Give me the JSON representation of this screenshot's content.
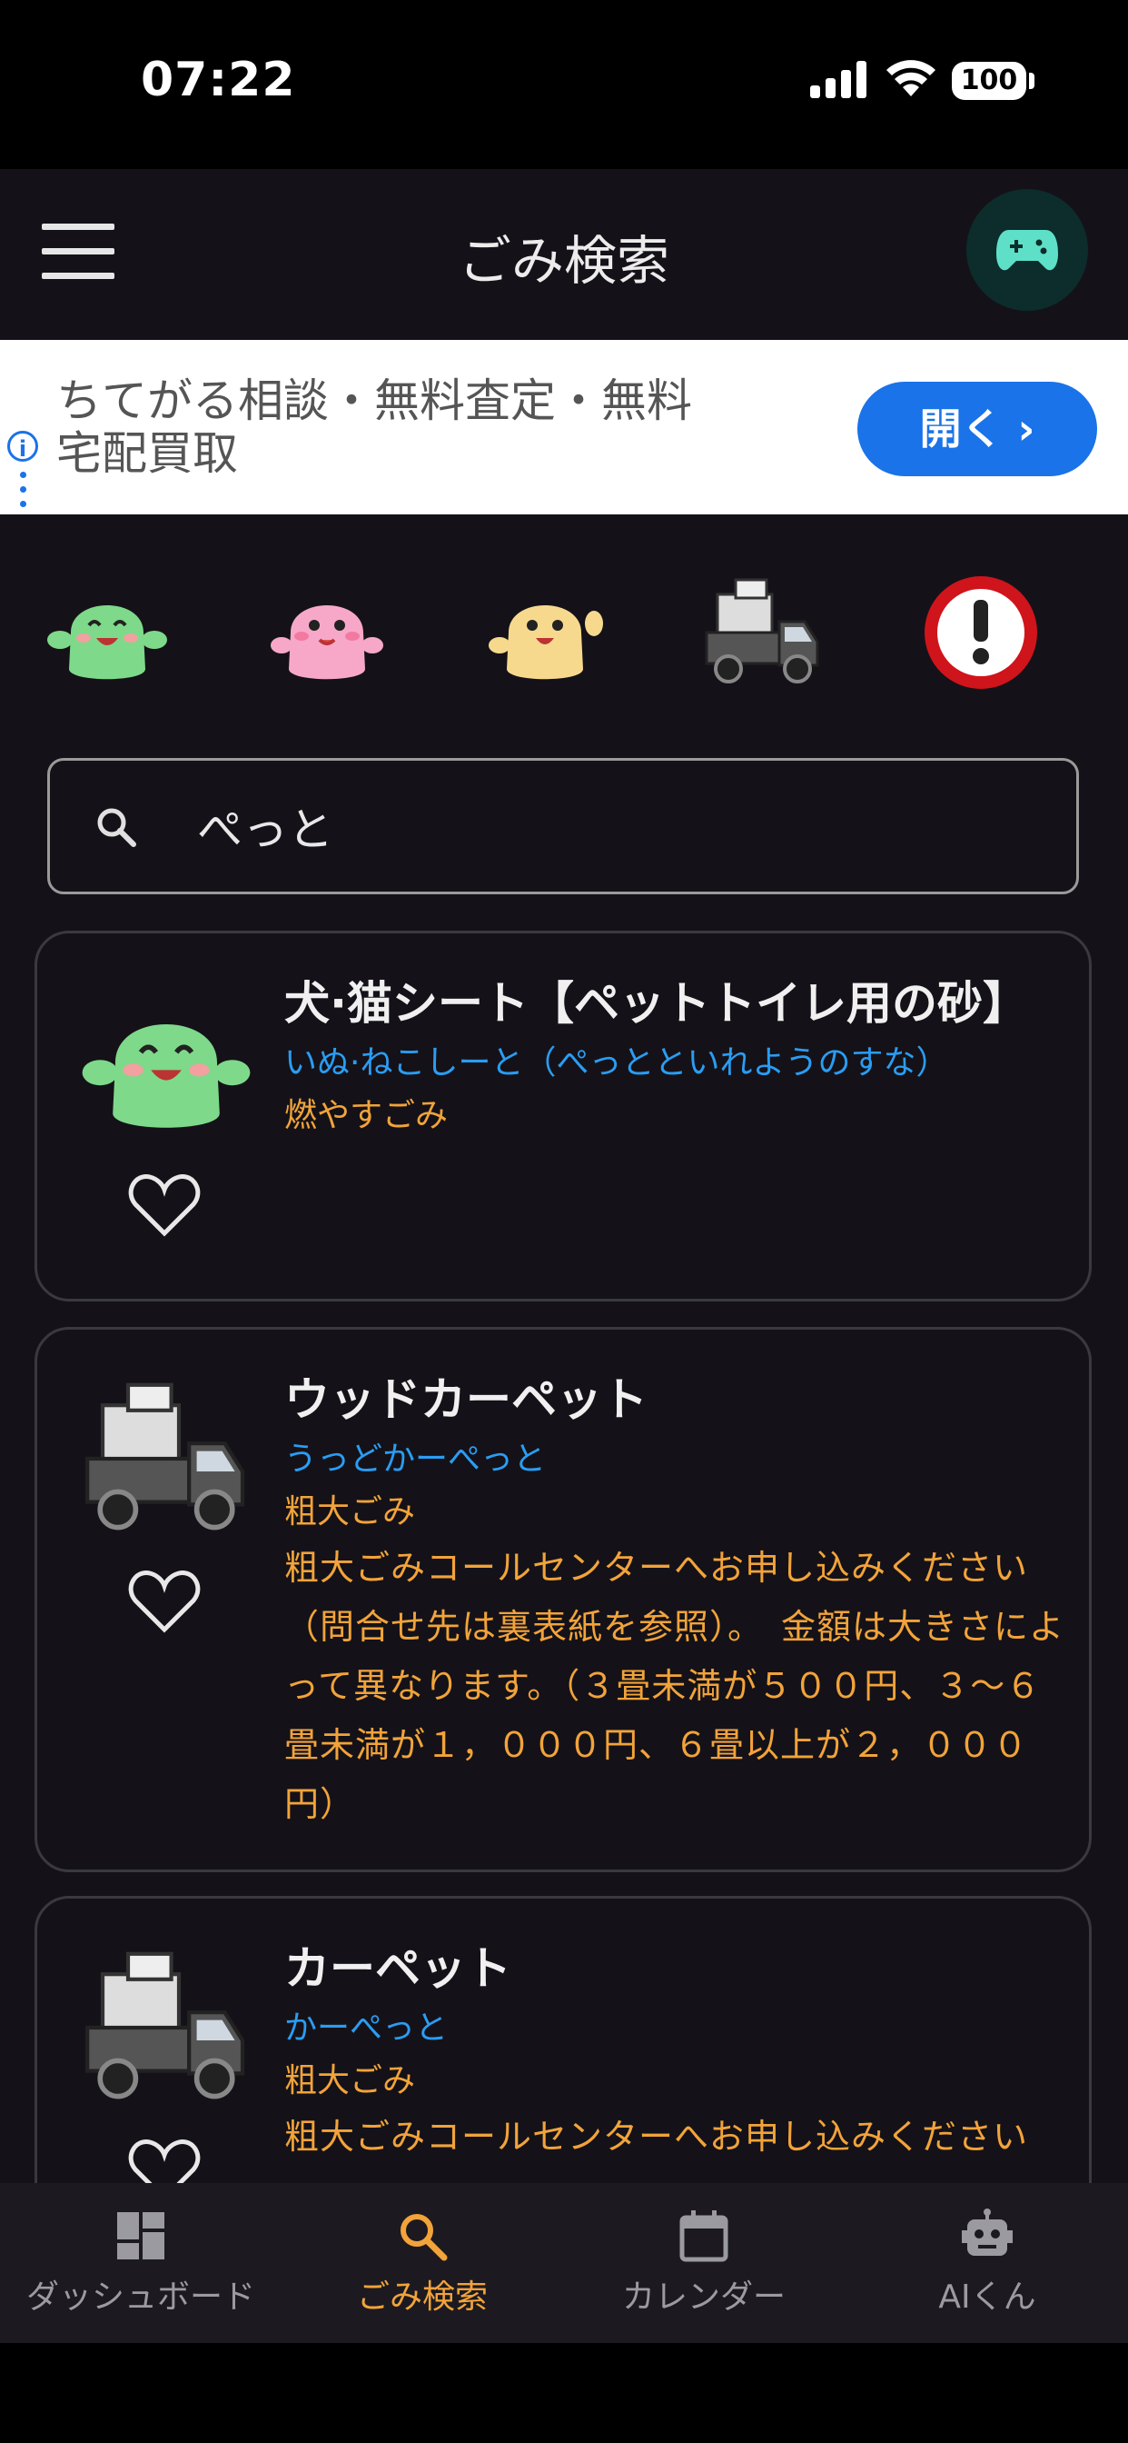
{
  "status": {
    "time": "07:22",
    "battery": "100"
  },
  "app_bar": {
    "title": "ごみ検索"
  },
  "ad": {
    "text_line1": "ちてがる相談・無料査定・無料",
    "text_line2": "宅配買取",
    "button_label": "開く  ›"
  },
  "search": {
    "value": "ぺっと",
    "placeholder": ""
  },
  "categories": [
    "green-character-icon",
    "pink-character-icon",
    "yellow-character-icon",
    "truck-icon",
    "warning-icon"
  ],
  "results": [
    {
      "title": "犬·猫シート【ペットトイレ用の砂】",
      "reading": "いぬ·ねこしーと（ぺっとといれようのすな）",
      "type": "燃やすごみ",
      "note": ""
    },
    {
      "title": "ウッドカーペット",
      "reading": "うっどかーぺっと",
      "type": "粗大ごみ",
      "note": "粗大ごみコールセンターへお申し込みください（問合せ先は裏表紙を参照）。　金額は大きさによって異なります。（３畳未満が５００円、３～６畳未満が１，０００円、６畳以上が２，０００円）"
    },
    {
      "title": "カーペット",
      "reading": "かーぺっと",
      "type": "粗大ごみ",
      "note": "粗大ごみコールセンターへお申し込みください"
    }
  ],
  "nav": [
    {
      "label": "ダッシュボード",
      "icon": "dashboard-icon"
    },
    {
      "label": "ごみ検索",
      "icon": "search-icon",
      "active": true
    },
    {
      "label": "カレンダー",
      "icon": "calendar-icon"
    },
    {
      "label": "AIくん",
      "icon": "robot-icon"
    }
  ],
  "colors": {
    "accent": "#f2a33a",
    "link": "#2a9df4",
    "background": "#141218"
  }
}
